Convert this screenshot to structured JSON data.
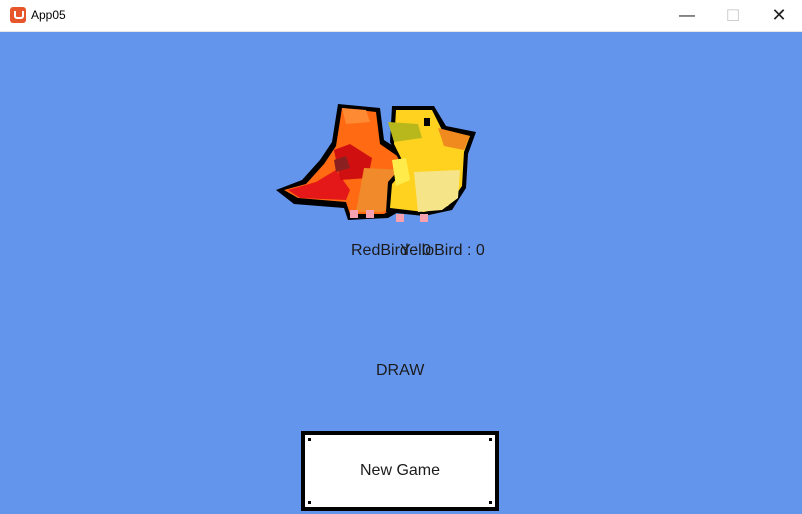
{
  "window": {
    "title": "App05",
    "minimize_glyph": "—",
    "maximize_glyph": "☐",
    "close_glyph": "✕"
  },
  "colors": {
    "background": "#6495ED",
    "red_bird": "#E8401C",
    "yellow_bird": "#FFD21F"
  },
  "scoreboard": {
    "red": "RedBird : 0",
    "yellow": "YelloBird : 0"
  },
  "result_text": "DRAW",
  "new_game_label": "New Game"
}
